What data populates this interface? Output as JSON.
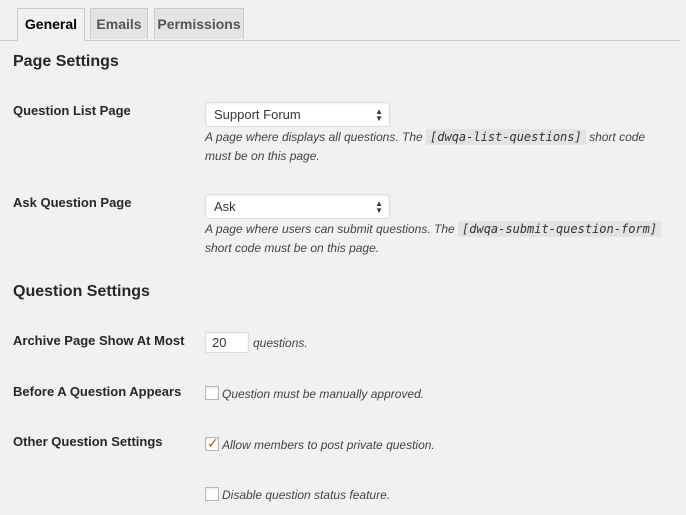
{
  "tabs": [
    {
      "label": "General",
      "active": true
    },
    {
      "label": "Emails",
      "active": false
    },
    {
      "label": "Permissions",
      "active": false
    }
  ],
  "sections": {
    "page_settings": "Page Settings",
    "question_settings": "Question Settings"
  },
  "question_list_page": {
    "label": "Question List Page",
    "selected": "Support Forum",
    "desc_before": "A page where displays all questions. The ",
    "code": "[dwqa-list-questions]",
    "desc_after": " short code must be on this page."
  },
  "ask_question_page": {
    "label": "Ask Question Page",
    "selected": "Ask",
    "desc_before": "A page where users can submit questions. The ",
    "code": "[dwqa-submit-question-form]",
    "desc_after": " short code must be on this page."
  },
  "archive_page": {
    "label": "Archive Page Show At Most",
    "value": "20",
    "suffix": "questions."
  },
  "before_question": {
    "label": "Before A Question Appears",
    "checkbox_label": "Question must be manually approved.",
    "checked": false
  },
  "other_settings": {
    "label": "Other Question Settings",
    "options": [
      {
        "label": "Allow members to post private question.",
        "checked": true
      },
      {
        "label": "Disable question status feature.",
        "checked": false
      }
    ]
  },
  "colors": {
    "background": "#f1f1f1",
    "checkmark": "#d54e21",
    "code_bg": "#e3e3e3"
  },
  "icons": {
    "select_arrows": "select-arrows-icon",
    "checkmark": "checkmark-icon"
  }
}
